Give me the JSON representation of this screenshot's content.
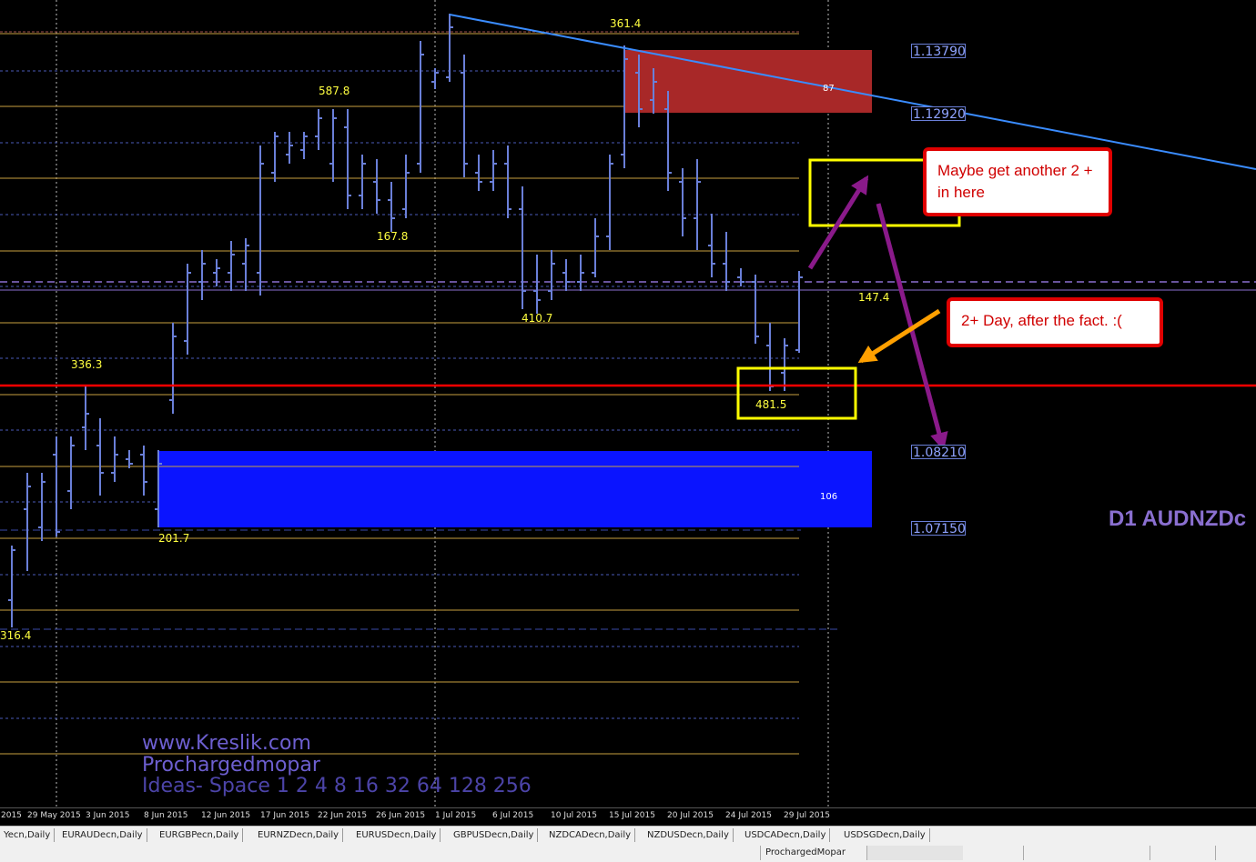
{
  "chart_data": {
    "type": "candlestick-ohlc",
    "symbol_label": "D1 AUDNZDc",
    "price_tags": [
      "1.13790",
      "1.12920",
      "1.08210",
      "1.07150"
    ],
    "x_dates": [
      "29 May 2015",
      "3 Jun 2015",
      "8 Jun 2015",
      "12 Jun 2015",
      "17 Jun 2015",
      "22 Jun 2015",
      "26 Jun 2015",
      "1 Jul 2015",
      "6 Jul 2015",
      "10 Jul 2015",
      "15 Jul 2015",
      "20 Jul 2015",
      "24 Jul 2015",
      "29 Jul 2015"
    ],
    "left_cut_date": "2015",
    "annotations": [
      {
        "text": "361.4"
      },
      {
        "text": "587.8"
      },
      {
        "text": "167.8"
      },
      {
        "text": "336.3"
      },
      {
        "text": "410.7"
      },
      {
        "text": "481.5"
      },
      {
        "text": "147.4"
      },
      {
        "text": "201.7"
      },
      {
        "text": "316.4"
      },
      {
        "text": "87"
      },
      {
        "text": "106"
      }
    ],
    "colors": {
      "background": "#000000",
      "bars": "#6a7fd8",
      "fib_lines": "#c8a040",
      "support_line": "#ff0000",
      "trend_line": "#3a8cff",
      "supply_zone": "#a82828",
      "demand_zone": "#0a14ff",
      "highlight_box": "#ffff00",
      "arrow_up": "#8a1a8a",
      "arrow_orange": "#ffa000"
    }
  },
  "callouts": {
    "top": "Maybe get another 2 + in here",
    "bottom": "2+ Day, after the fact. :("
  },
  "watermark": {
    "site": "www.Kreslik.com",
    "author": "Prochargedmopar",
    "ideas": "Ideas- Space 1 2 4 8 16 32 64 128 256"
  },
  "tabs": [
    "Yecn,Daily",
    "EURAUDecn,Daily",
    "EURGBPecn,Daily",
    "EURNZDecn,Daily",
    "EURUSDecn,Daily",
    "GBPUSDecn,Daily",
    "NZDCADecn,Daily",
    "NZDUSDecn,Daily",
    "USDCADecn,Daily",
    "USDSGDecn,Daily"
  ],
  "status": {
    "profile": "ProchargedMopar"
  }
}
